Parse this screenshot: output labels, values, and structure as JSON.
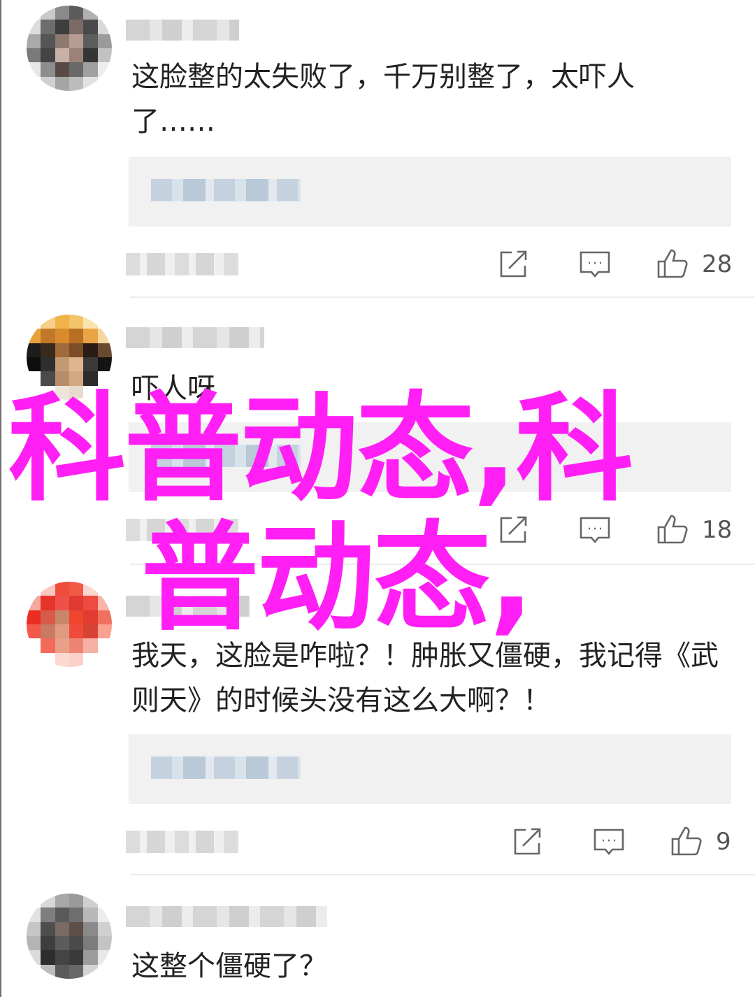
{
  "comments": [
    {
      "text": "这脸整的太失败了，千万别整了，太吓人了……",
      "like_count": "28",
      "avatar_colors": [
        "#f2f2f2",
        "#c9c9c9",
        "#8a8a8a",
        "#5c5c5c",
        "#b0b0b0",
        "#f5f5f5",
        "#dcdcdc",
        "#6d6d6d",
        "#3e3e3e",
        "#7c6a66",
        "#4a4a4a",
        "#d8d8d8",
        "#a9a9a9",
        "#555555",
        "#8f7a72",
        "#b49c92",
        "#5d5d5d",
        "#9a9a9a",
        "#7a7a7a",
        "#444444",
        "#c8b2a8",
        "#9c8278",
        "#353535",
        "#c2c2c2",
        "#e8e8e8",
        "#8d8d8d",
        "#5a4a46",
        "#696969",
        "#a0a0a0",
        "#eeeeee",
        "#ffffff",
        "#d0d0d0",
        "#a5a5a5",
        "#bcbcbc",
        "#e2e2e2",
        "#ffffff"
      ]
    },
    {
      "text": "吓人呀",
      "like_count": "18",
      "avatar_colors": [
        "#ffffff",
        "#f6d08a",
        "#f1b24a",
        "#f4c46a",
        "#fbe3b1",
        "#ffffff",
        "#e7a33a",
        "#c0782a",
        "#d98a2c",
        "#b86f22",
        "#e9a444",
        "#f6d7a0",
        "#1c1c1c",
        "#3a2a1c",
        "#a06a3a",
        "#7c4d26",
        "#2a1c14",
        "#6a4a2e",
        "#0e0e0e",
        "#2e2e2e",
        "#c49a74",
        "#e0b48c",
        "#3a3a3a",
        "#141414",
        "#ffffff",
        "#4a4a4a",
        "#b88c6a",
        "#d4a882",
        "#2c2c2c",
        "#ffffff",
        "#ffffff",
        "#ffffff",
        "#efe4da",
        "#e8dccf",
        "#ffffff",
        "#ffffff"
      ]
    },
    {
      "text": "我天，这脸是咋啦？！肿胀又僵硬，我记得《武则天》的时候头没有这么大啊？！",
      "like_count": "9",
      "avatar_colors": [
        "#ffffff",
        "#f9c7c2",
        "#f04c3c",
        "#f25a48",
        "#fbd5cf",
        "#ffffff",
        "#f5a89e",
        "#e5342a",
        "#f0504a",
        "#e03a32",
        "#ee4a40",
        "#fab4aa",
        "#ea2e24",
        "#d95a48",
        "#c8866a",
        "#f0462e",
        "#e23c30",
        "#f07060",
        "#f4584a",
        "#c87a62",
        "#e09a80",
        "#ef4a3a",
        "#d64234",
        "#f9a090",
        "#ffffff",
        "#f26a5a",
        "#e8a088",
        "#f08474",
        "#f6b0a4",
        "#ffffff",
        "#ffffff",
        "#ffffff",
        "#fcd8d0",
        "#fbd0c8",
        "#ffffff",
        "#ffffff"
      ]
    },
    {
      "text": "这整个僵硬了？",
      "like_count": "",
      "avatar_colors": [
        "#ffffff",
        "#d8d8d8",
        "#a8a8a8",
        "#9a9a9a",
        "#cfcfcf",
        "#ffffff",
        "#e2e2e2",
        "#7e7e7e",
        "#5a5a5a",
        "#6e6e6e",
        "#b8b8b8",
        "#ececec",
        "#c6c6c6",
        "#4e4e4e",
        "#7a6a64",
        "#5e4e48",
        "#8a8a8a",
        "#d0d0d0",
        "#b4b4b4",
        "#3e3e3e",
        "#5c5c5c",
        "#4a4a4a",
        "#7c7c7c",
        "#c4c4c4",
        "#dcdcdc",
        "#2e2e2e",
        "#444444",
        "#3a3a3a",
        "#9c9c9c",
        "#e8e8e8",
        "#ffffff",
        "#bcbcbc",
        "#5a5a5a",
        "#686868",
        "#d4d4d4",
        "#ffffff"
      ]
    }
  ],
  "overlay": {
    "line1": "科普动态,科",
    "line2": "普动态,"
  },
  "icons": {
    "share": "share-icon",
    "reply": "comment-icon",
    "like": "thumbs-up-icon"
  },
  "colors": {
    "overlay": "#ff1ff5",
    "reply_box": "#f1f1f1"
  }
}
